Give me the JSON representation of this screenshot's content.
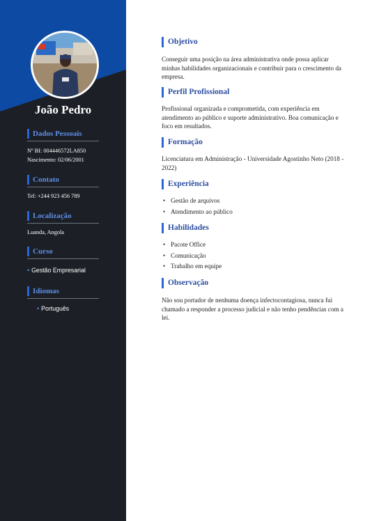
{
  "sidebar": {
    "name": "João Pedro",
    "sections": {
      "personal": {
        "title": "Dados Pessoais",
        "lines": [
          "Nº BI: 004446572LA850",
          "Nascimento: 02/06/2001"
        ]
      },
      "contact": {
        "title": "Contato",
        "lines": [
          "Tel: +244 923 456 789"
        ]
      },
      "location": {
        "title": "Localização",
        "lines": [
          "Luanda, Angola"
        ]
      },
      "course": {
        "title": "Curso",
        "items": [
          "Gestão Empresarial"
        ]
      },
      "languages": {
        "title": "Idiomas",
        "items": [
          "Português"
        ]
      }
    }
  },
  "main": {
    "objective": {
      "title": "Objetivo",
      "text": "Conseguir uma posição na área administrativa onde possa aplicar minhas habilidades organizacionais e contribuir para o crescimento da empresa."
    },
    "profile": {
      "title": "Perfil Profissional",
      "text": "Profissional organizada e comprometida, com experiência em atendimento ao público e suporte administrativo. Boa comunicação e foco em resultados."
    },
    "education": {
      "title": "Formação",
      "text": "Licenciatura em Administração - Universidade Agostinho Neto (2018 - 2022)"
    },
    "experience": {
      "title": "Experiência",
      "items": [
        "Gestão de arquivos",
        "Atendimento ao público"
      ]
    },
    "skills": {
      "title": "Habilidades",
      "items": [
        "Pacote Office",
        "Comunicação",
        "Trabalho em equipe"
      ]
    },
    "note": {
      "title": "Observação",
      "text": "Não sou portador de nenhuma doença infectocontagiosa, nunca fui chamado a responder a processo judicial e não tenho pendências com a lei."
    }
  },
  "colors": {
    "sidebar": "#1c1f26",
    "accent_blue": "#0d4aa3",
    "heading": "#2b4da0",
    "side_heading": "#5d8ee6"
  },
  "icons": {
    "bullet": "•"
  }
}
